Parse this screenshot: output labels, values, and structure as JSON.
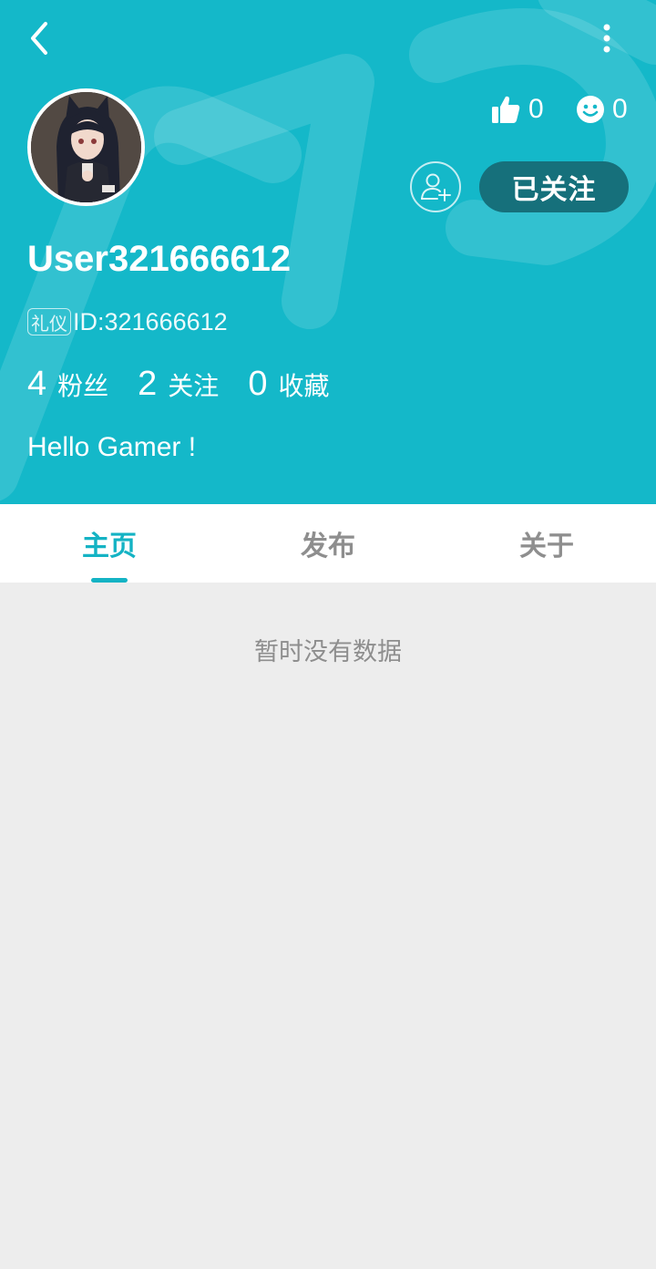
{
  "header": {
    "back_icon": "chevron-left-icon",
    "more_icon": "more-vertical-icon",
    "bg_color": "#14b8c9"
  },
  "profile": {
    "username": "User321666612",
    "tag": "礼仪",
    "id_text": "ID:321666612",
    "likes": "0",
    "emoji_count": "0",
    "follow_label": "已关注",
    "bio": "Hello Gamer !",
    "counts": [
      {
        "value": "4",
        "label": "粉丝"
      },
      {
        "value": "2",
        "label": "关注"
      },
      {
        "value": "0",
        "label": "收藏"
      }
    ]
  },
  "tabs": [
    {
      "label": "主页",
      "active": true
    },
    {
      "label": "发布",
      "active": false
    },
    {
      "label": "关于",
      "active": false
    }
  ],
  "content": {
    "empty_text": "暂时没有数据"
  },
  "colors": {
    "accent": "#14b3c4",
    "follow_button": "#16707b",
    "background": "#ededed"
  }
}
